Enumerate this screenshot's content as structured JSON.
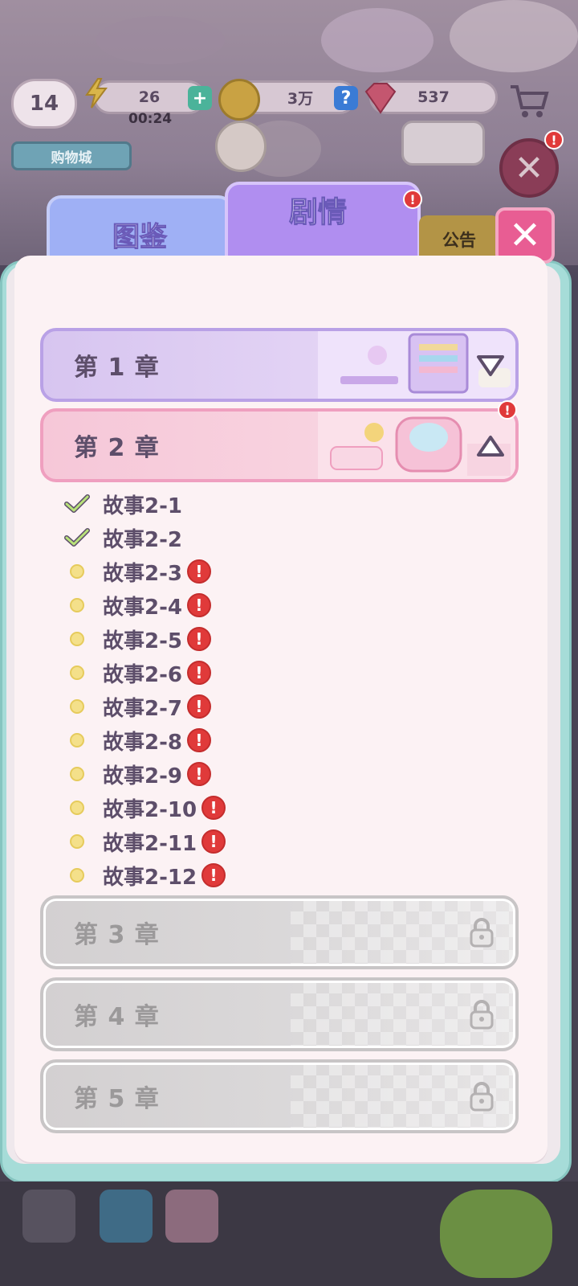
{
  "hud": {
    "level": "14",
    "energy": "26",
    "energy_timer": "00:24",
    "coins": "3万",
    "gems": "537",
    "shop_label": "购物城",
    "colors": {
      "energy_plus": "#4bb39a",
      "coin_help": "#3a7bd5",
      "accent_red": "#e03a3a"
    }
  },
  "tabs": {
    "codex": "图鉴",
    "story": "剧情",
    "notice": "公告",
    "story_badge": "!",
    "close_icon": "close-icon"
  },
  "chapters": [
    {
      "label": "第 1 章",
      "state": "collapsed"
    },
    {
      "label": "第 2 章",
      "state": "expanded",
      "badge": "!"
    },
    {
      "label": "第 3 章",
      "state": "locked"
    },
    {
      "label": "第 4 章",
      "state": "locked"
    },
    {
      "label": "第 5 章",
      "state": "locked"
    }
  ],
  "stories": [
    {
      "title": "故事2-1",
      "status": "done"
    },
    {
      "title": "故事2-2",
      "status": "done"
    },
    {
      "title": "故事2-3",
      "status": "new",
      "badge": "!"
    },
    {
      "title": "故事2-4",
      "status": "new",
      "badge": "!"
    },
    {
      "title": "故事2-5",
      "status": "new",
      "badge": "!"
    },
    {
      "title": "故事2-6",
      "status": "new",
      "badge": "!"
    },
    {
      "title": "故事2-7",
      "status": "new",
      "badge": "!"
    },
    {
      "title": "故事2-8",
      "status": "new",
      "badge": "!"
    },
    {
      "title": "故事2-9",
      "status": "new",
      "badge": "!"
    },
    {
      "title": "故事2-10",
      "status": "new",
      "badge": "!"
    },
    {
      "title": "故事2-11",
      "status": "new",
      "badge": "!"
    },
    {
      "title": "故事2-12",
      "status": "new",
      "badge": "!"
    }
  ]
}
